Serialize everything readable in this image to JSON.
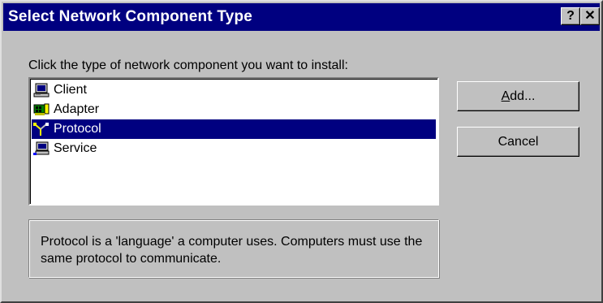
{
  "window": {
    "title": "Select Network Component Type",
    "help_glyph": "?",
    "close_glyph": "✕"
  },
  "prompt": "Click the type of network component you want to install:",
  "list": {
    "items": [
      {
        "label": "Client",
        "icon": "client-computer-icon",
        "selected": false
      },
      {
        "label": "Adapter",
        "icon": "network-adapter-icon",
        "selected": false
      },
      {
        "label": "Protocol",
        "icon": "protocol-icon",
        "selected": true
      },
      {
        "label": "Service",
        "icon": "service-icon",
        "selected": false
      }
    ]
  },
  "description": "Protocol is a 'language' a computer uses. Computers must use the same protocol to communicate.",
  "buttons": {
    "add": {
      "accel": "A",
      "rest": "dd..."
    },
    "cancel": "Cancel"
  },
  "colors": {
    "face": "#c0c0c0",
    "titlebar": "#000080",
    "selection": "#000080"
  }
}
